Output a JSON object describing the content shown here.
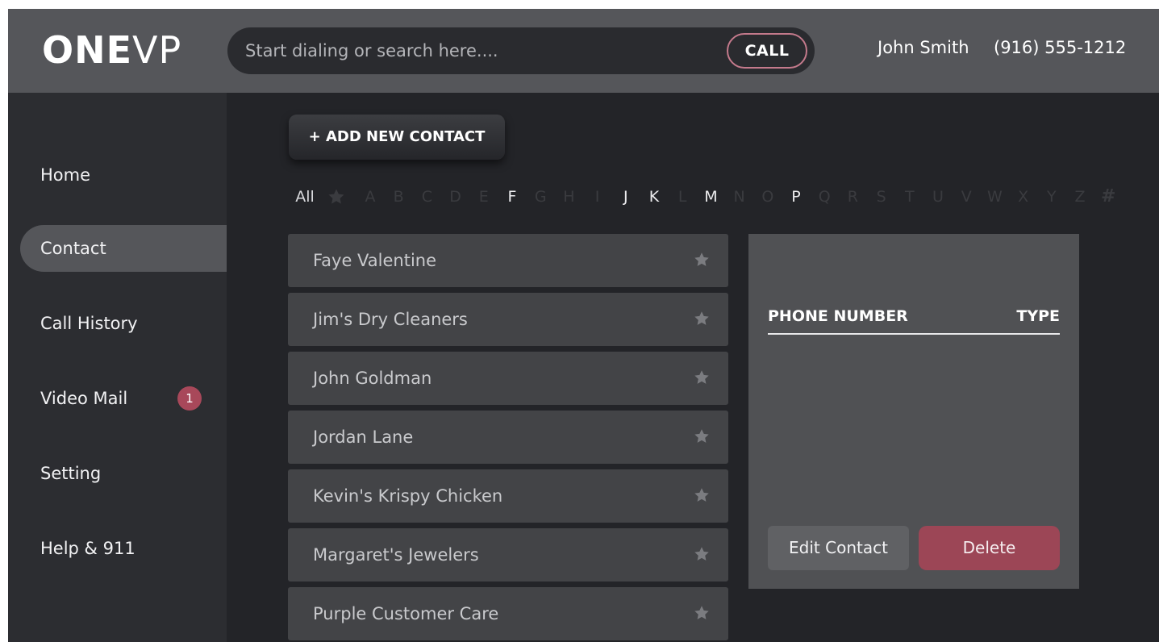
{
  "header": {
    "logo_bold": "ONE",
    "logo_thin": "VP",
    "search_placeholder": "Start dialing or search here....",
    "call_label": "CALL",
    "user_name": "John Smith",
    "user_phone": "(916) 555-1212"
  },
  "sidebar": {
    "items": [
      {
        "label": "Home",
        "active": false
      },
      {
        "label": "Contact",
        "active": true
      },
      {
        "label": "Call History",
        "active": false
      },
      {
        "label": "Video Mail",
        "active": false,
        "badge": "1"
      },
      {
        "label": "Setting",
        "active": false
      },
      {
        "label": "Help & 911",
        "active": false
      }
    ]
  },
  "main": {
    "add_contact_label": "+ ADD NEW CONTACT",
    "alphabet": {
      "all_label": "All",
      "letters": [
        {
          "label": "A",
          "enabled": false
        },
        {
          "label": "B",
          "enabled": false
        },
        {
          "label": "C",
          "enabled": false
        },
        {
          "label": "D",
          "enabled": false
        },
        {
          "label": "E",
          "enabled": false
        },
        {
          "label": "F",
          "enabled": true
        },
        {
          "label": "G",
          "enabled": false
        },
        {
          "label": "H",
          "enabled": false
        },
        {
          "label": "I",
          "enabled": false
        },
        {
          "label": "J",
          "enabled": true
        },
        {
          "label": "K",
          "enabled": true
        },
        {
          "label": "L",
          "enabled": false
        },
        {
          "label": "M",
          "enabled": true
        },
        {
          "label": "N",
          "enabled": false
        },
        {
          "label": "O",
          "enabled": false
        },
        {
          "label": "P",
          "enabled": true
        },
        {
          "label": "Q",
          "enabled": false
        },
        {
          "label": "R",
          "enabled": false
        },
        {
          "label": "S",
          "enabled": false
        },
        {
          "label": "T",
          "enabled": false
        },
        {
          "label": "U",
          "enabled": false
        },
        {
          "label": "V",
          "enabled": false
        },
        {
          "label": "W",
          "enabled": false
        },
        {
          "label": "X",
          "enabled": false
        },
        {
          "label": "Y",
          "enabled": false
        },
        {
          "label": "Z",
          "enabled": false
        },
        {
          "label": "#",
          "enabled": false
        }
      ]
    },
    "contacts": [
      {
        "name": "Faye Valentine"
      },
      {
        "name": "Jim's Dry Cleaners"
      },
      {
        "name": "John Goldman"
      },
      {
        "name": "Jordan Lane"
      },
      {
        "name": "Kevin's Krispy Chicken"
      },
      {
        "name": "Margaret's Jewelers"
      },
      {
        "name": "Purple Customer Care"
      }
    ]
  },
  "detail": {
    "col_phone": "PHONE NUMBER",
    "col_type": "TYPE",
    "edit_label": "Edit Contact",
    "delete_label": "Delete"
  },
  "colors": {
    "background": "#232428",
    "topbar": "#55565a",
    "accent_delete": "#9c4656",
    "badge": "#a8485a",
    "call_border": "#c47a8c"
  }
}
